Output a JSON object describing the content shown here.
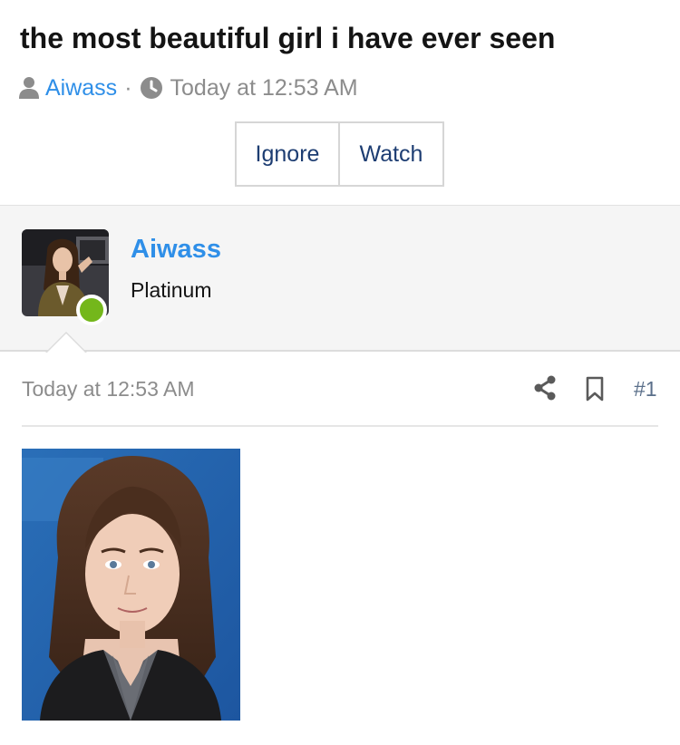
{
  "thread": {
    "title": "the most beautiful girl i have ever seen",
    "author": "Aiwass",
    "separator": "·",
    "date": "Today at 12:53 AM",
    "icons": {
      "author": "user-icon",
      "date": "clock-icon"
    }
  },
  "actions": {
    "ignore_label": "Ignore",
    "watch_label": "Watch"
  },
  "post": {
    "author": {
      "name": "Aiwass",
      "user_title": "Platinum",
      "avatar": "avatar-photo",
      "online": true
    },
    "date": "Today at 12:53 AM",
    "number": "#1",
    "tools": [
      "share-icon",
      "bookmark-icon"
    ],
    "attachment": "portrait-photo"
  },
  "colors": {
    "link": "#2f8fe8",
    "button_text": "#1d3d72",
    "muted": "#8c8c8c",
    "online": "#74b71b",
    "panel_bg": "#f5f5f5"
  }
}
